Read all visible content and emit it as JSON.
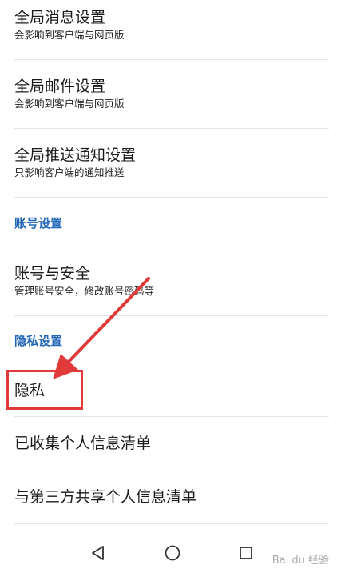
{
  "settings": {
    "global_message": {
      "title": "全局消息设置",
      "subtitle": "会影响到客户端与网页版"
    },
    "global_mail": {
      "title": "全局邮件设置",
      "subtitle": "会影响到客户端与网页版"
    },
    "global_push": {
      "title": "全局推送通知设置",
      "subtitle": "只影响客户端的通知推送"
    },
    "account_section": "账号设置",
    "account_security": {
      "title": "账号与安全",
      "subtitle": "管理账号安全，修改账号密码等"
    },
    "privacy_section": "隐私设置",
    "privacy": {
      "title": "隐私"
    },
    "collected_info": {
      "title": "已收集个人信息清单"
    },
    "third_party_info": {
      "title": "与第三方共享个人信息清单"
    }
  },
  "navbar": {
    "back_icon": "triangle-back-icon",
    "home_icon": "circle-home-icon",
    "recents_icon": "square-recents-icon"
  },
  "watermark": "Bai du 经验",
  "annotation": {
    "highlight_color": "#e03a3a"
  },
  "colors": {
    "section_header": "#2267b8",
    "divider": "#e6e6e6"
  }
}
